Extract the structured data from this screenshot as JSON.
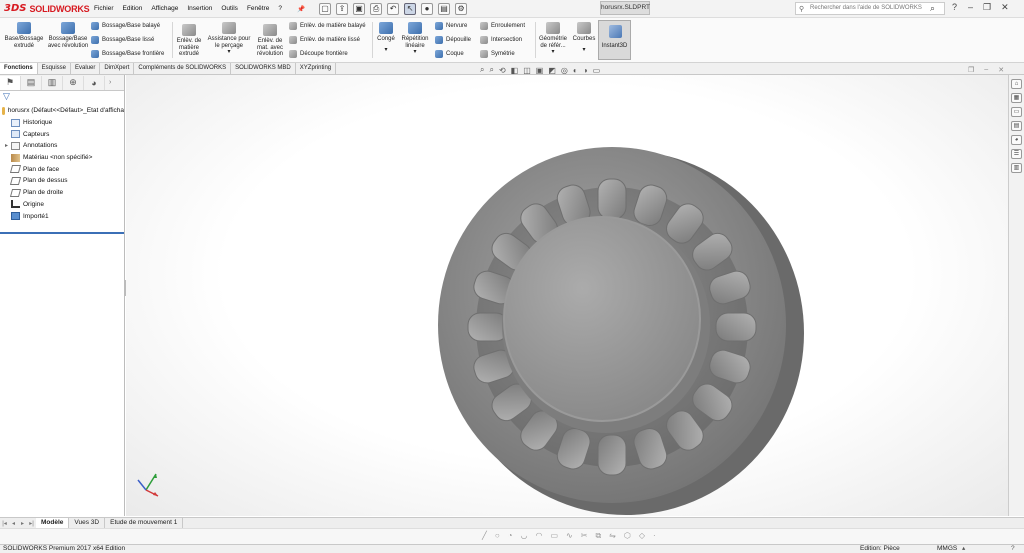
{
  "app": {
    "logo_ds": "3DS",
    "logo_name": "SOLIDWORKS",
    "document_title": "horusrx.SLDPRT"
  },
  "menus": [
    "Fichier",
    "Edition",
    "Affichage",
    "Insertion",
    "Outils",
    "Fenêtre",
    "?"
  ],
  "search": {
    "placeholder": "Rechercher dans l'aide de SOLIDWORKS"
  },
  "ribbon": {
    "extrude_boss": "Base/Bossage extrudé",
    "revolve_boss": "Bossage/Base avec révolution",
    "swept_boss": "Bossage/Base balayé",
    "loft_boss": "Bossage/Base lissé",
    "boundary_boss": "Bossage/Base frontière",
    "extruded_cut": "Enlèv. de matière extrudé",
    "hole_wizard": "Assistance pour le perçage",
    "revolved_cut": "Enlèv. de mat. avec révolution",
    "swept_cut": "Enlèv. de matière balayé",
    "lofted_cut": "Enlèv. de matière lissé",
    "boundary_cut": "Découpe frontière",
    "fillet": "Congé",
    "linear_pattern": "Répétition linéaire",
    "rib": "Nervure",
    "draft": "Dépouille",
    "shell": "Coque",
    "wrap": "Enroulement",
    "intersect": "Intersection",
    "mirror": "Symétrie",
    "reference_geometry": "Géométrie de référ...",
    "curves": "Courbes",
    "instant3d": "Instant3D",
    "dropdown_arrow": "▾"
  },
  "command_tabs": [
    "Fonctions",
    "Esquisse",
    "Evaluer",
    "DimXpert",
    "Compléments de SOLIDWORKS",
    "SOLIDWORKS MBD",
    "XYZprinting"
  ],
  "feature_tree": {
    "root": "horusrx  (Défaut<<Défaut>_Etat d'afficha",
    "items": [
      "Historique",
      "Capteurs",
      "Annotations",
      "Matériau <non spécifié>",
      "Plan de face",
      "Plan de dessus",
      "Plan de droite",
      "Origine",
      "Importé1"
    ]
  },
  "bottom_tabs": [
    "Modèle",
    "Vues 3D",
    "Etude de mouvement 1"
  ],
  "status": {
    "app_version": "SOLIDWORKS Premium 2017 x64 Edition",
    "mode": "Edition: Pièce",
    "units": "MMGS",
    "caret": "▴",
    "help": "?"
  },
  "colors": {
    "brand_red": "#d71920",
    "accent_blue": "#3b6fb6",
    "model_grey": "#8c8c8c"
  }
}
